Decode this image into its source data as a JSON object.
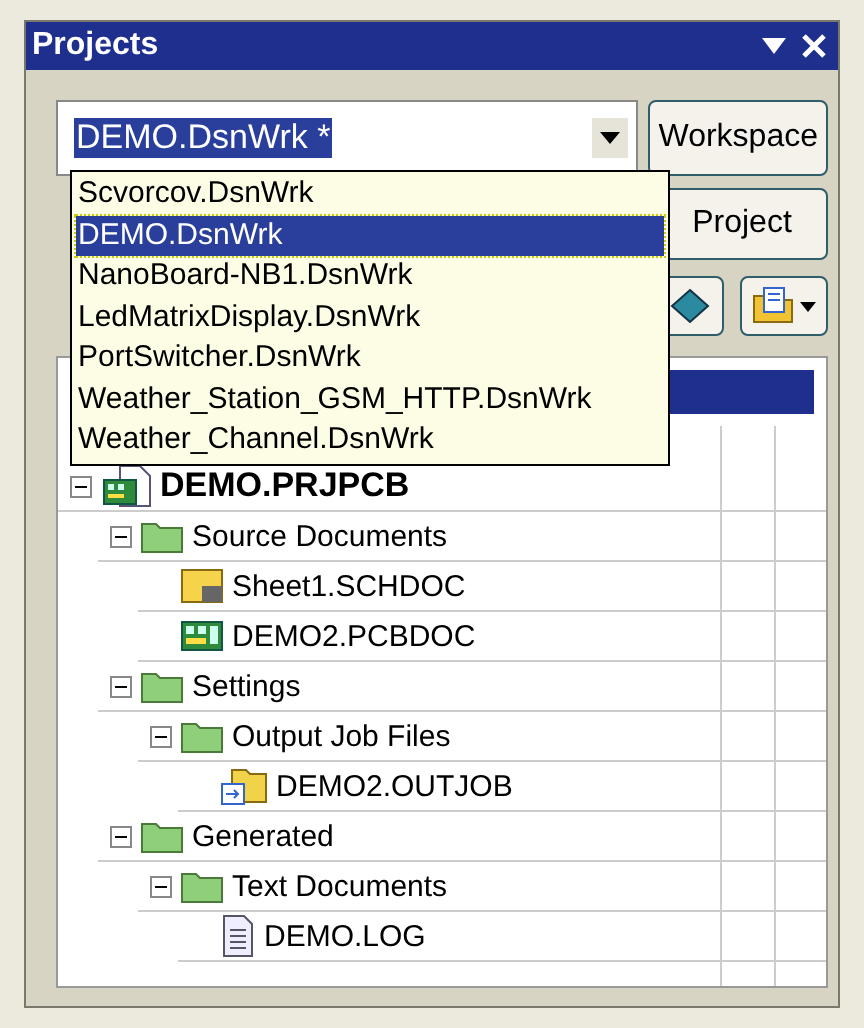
{
  "panel": {
    "title": "Projects",
    "workspace_combo": {
      "value": "DEMO.DsnWrk *",
      "expanded": true
    },
    "buttons": [
      "Workspace",
      "Project"
    ]
  },
  "dropdown": [
    {
      "label": "Scvorcov.DsnWrk",
      "selected": false
    },
    {
      "label": "DEMO.DsnWrk",
      "selected": true
    },
    {
      "label": "NanoBoard-NB1.DsnWrk",
      "selected": false
    },
    {
      "label": "LedMatrixDisplay.DsnWrk",
      "selected": false
    },
    {
      "label": "PortSwitcher.DsnWrk",
      "selected": false
    },
    {
      "label": "Weather_Station_GSM_HTTP.DsnWrk",
      "selected": false
    },
    {
      "label": "Weather_Channel.DsnWrk",
      "selected": false
    }
  ],
  "tree": [
    {
      "label": "DEMO.PRJPCB",
      "kind": "project",
      "expanded": true,
      "children": [
        {
          "label": "Source Documents",
          "kind": "folder",
          "expanded": true,
          "children": [
            {
              "label": "Sheet1.SCHDOC",
              "kind": "schematic"
            },
            {
              "label": "DEMO2.PCBDOC",
              "kind": "pcb"
            }
          ]
        },
        {
          "label": "Settings",
          "kind": "folder",
          "expanded": true,
          "children": [
            {
              "label": "Output Job Files",
              "kind": "folder",
              "expanded": true,
              "children": [
                {
                  "label": "DEMO2.OUTJOB",
                  "kind": "outjob"
                }
              ]
            }
          ]
        },
        {
          "label": "Generated",
          "kind": "folder",
          "expanded": true,
          "children": [
            {
              "label": "Text Documents",
              "kind": "folder",
              "expanded": true,
              "children": [
                {
                  "label": "DEMO.LOG",
                  "kind": "text"
                }
              ]
            }
          ]
        }
      ]
    }
  ]
}
